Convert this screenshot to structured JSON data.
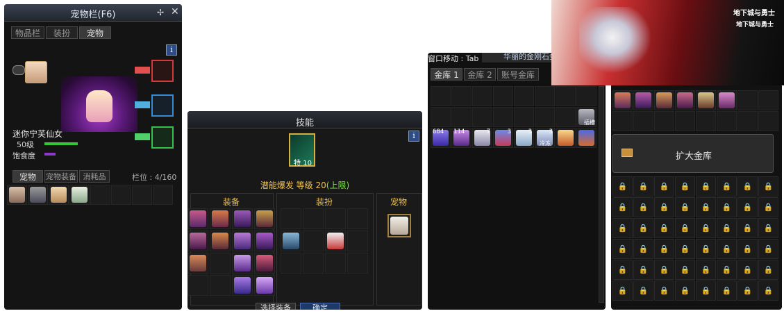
{
  "pet_window": {
    "title": "宠物栏(F6)",
    "tabs": [
      "物品栏",
      "装扮",
      "宠物"
    ],
    "info": "i",
    "pet_name": "迷你宁芙仙女",
    "level": "50级",
    "satiety_label": "饱食度",
    "lower_tabs": [
      "宠物",
      "宠物装备",
      "消耗品"
    ],
    "slot_label": "栏位 : 4/160"
  },
  "skill_window": {
    "title": "技能",
    "info": "i",
    "skill_badge": "特 10",
    "awaken_text": "潜能爆发 等级 20",
    "awaken_max": "(上限)",
    "columns": [
      "装备",
      "装扮",
      "宠物"
    ],
    "buttons": [
      "选择装备",
      "确定"
    ]
  },
  "bank_window": {
    "move_hint": "窗口移动 : Tab",
    "banner": "华丽的金刚石金库",
    "tabs": [
      "金库 1",
      "金库 2",
      "账号金库"
    ],
    "item_counts": [
      "684",
      "114",
      "7",
      "3",
      "3",
      "3",
      "",
      ""
    ],
    "tag_plug": "插槽",
    "tag_cold": "冷冻"
  },
  "bank_right": {
    "expand_label": "扩大金库"
  },
  "ad": {
    "logo1": "地下城与勇士",
    "logo2": "地下城与勇士"
  },
  "colors": {
    "accent_gold": "#f2c24e",
    "green_text": "#7fe34a",
    "bar_green": "#37c837",
    "bar_purple": "#8c38c8"
  }
}
